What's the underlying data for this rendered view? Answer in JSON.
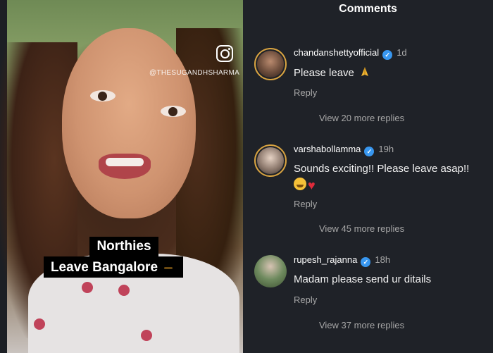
{
  "video": {
    "handle": "@THESUGANDHSHARMA",
    "caption_line1": "Northies",
    "caption_line2": "Leave Bangalore"
  },
  "comments_panel": {
    "title": "Comments",
    "items": [
      {
        "username": "chandanshettyofficial",
        "time": "1d",
        "text": "Please leave",
        "reply_label": "Reply",
        "more_replies": "View 20 more replies"
      },
      {
        "username": "varshabollamma",
        "time": "19h",
        "text": "Sounds exciting!! Please leave asap!!",
        "reply_label": "Reply",
        "more_replies": "View 45 more replies"
      },
      {
        "username": "rupesh_rajanna",
        "time": "18h",
        "text": "Madam please send ur ditails",
        "reply_label": "Reply",
        "more_replies": "View 37 more replies"
      }
    ]
  },
  "colors": {
    "panel_bg": "#1f2228",
    "verified": "#3897f0",
    "story_ring": "#d9a441"
  },
  "icons": [
    "instagram-icon",
    "verified-icon",
    "pray-emoji-icon",
    "hug-emoji-icon",
    "heart-emoji-icon",
    "worried-emoji-icon"
  ]
}
